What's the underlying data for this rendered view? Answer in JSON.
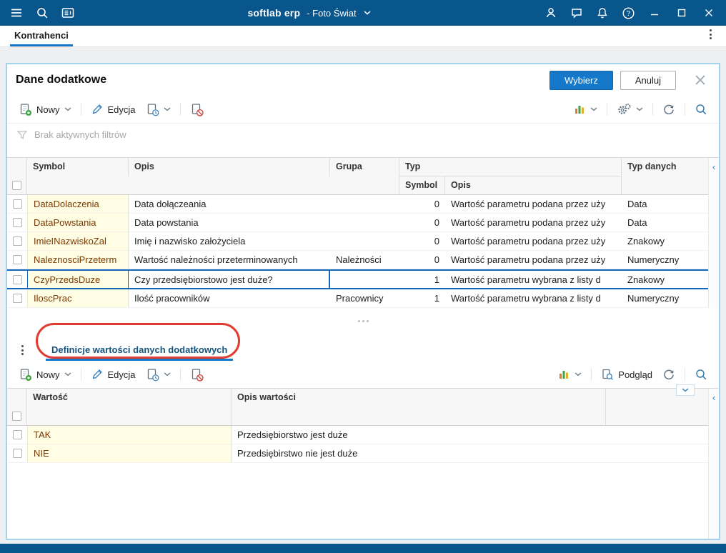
{
  "colors": {
    "topbar": "#09568c",
    "accent": "#1678c8",
    "selection": "#1466b8",
    "annotation_red": "#e23b30",
    "key_cell_bg": "#fffde3",
    "key_text": "#7b3800"
  },
  "titlebar": {
    "brand": "softlab erp",
    "workspace": "- Foto Świat"
  },
  "tabbar": {
    "active_tab": "Kontrahenci"
  },
  "dialog": {
    "title": "Dane dodatkowe",
    "buttons": {
      "select": "Wybierz",
      "cancel": "Anuluj"
    }
  },
  "toolbar": {
    "new": "Nowy",
    "edit": "Edycja",
    "preview": "Podgląd"
  },
  "filter": {
    "status": "Brak aktywnych filtrów"
  },
  "table1": {
    "headers": {
      "symbol": "Symbol",
      "opis": "Opis",
      "grupa": "Grupa",
      "typ": "Typ",
      "typ_symbol": "Symbol",
      "typ_opis": "Opis",
      "typ_danych": "Typ danych"
    },
    "rows": [
      {
        "symbol": "DataDolaczenia",
        "opis": "Data dołączeania",
        "grupa": "",
        "typ_symbol": "0",
        "typ_opis": "Wartość parametru podana przez uży",
        "typ_danych": "Data"
      },
      {
        "symbol": "DataPowstania",
        "opis": "Data powstania",
        "grupa": "",
        "typ_symbol": "0",
        "typ_opis": "Wartość parametru podana przez uży",
        "typ_danych": "Data"
      },
      {
        "symbol": "ImieINazwiskoZal",
        "opis": "Imię i nazwisko założyciela",
        "grupa": "",
        "typ_symbol": "0",
        "typ_opis": "Wartość parametru podana przez uży",
        "typ_danych": "Znakowy"
      },
      {
        "symbol": "NaleznosciPrzeterm",
        "opis": "Wartość należności przeterminowanych",
        "grupa": "Należności",
        "typ_symbol": "0",
        "typ_opis": "Wartość parametru podana przez uży",
        "typ_danych": "Numeryczny"
      },
      {
        "symbol": "CzyPrzedsDuze",
        "opis": "Czy przedsiębiorstowo jest duże?",
        "grupa": "",
        "typ_symbol": "1",
        "typ_opis": "Wartość parametru wybrana z listy d",
        "typ_danych": "Znakowy"
      },
      {
        "symbol": "IloscPrac",
        "opis": "Ilość pracowników",
        "grupa": "Pracownicy",
        "typ_symbol": "1",
        "typ_opis": "Wartość parametru wybrana z listy d",
        "typ_danych": "Numeryczny"
      }
    ]
  },
  "section2": {
    "title": "Definicje wartości danych dodatkowych"
  },
  "table2": {
    "headers": {
      "wartosc": "Wartość",
      "opis": "Opis wartości"
    },
    "rows": [
      {
        "wartosc": "TAK",
        "opis": "Przedsiębiorstwo jest duże"
      },
      {
        "wartosc": "NIE",
        "opis": "Przedsiębirstwo nie jest duże"
      }
    ]
  }
}
